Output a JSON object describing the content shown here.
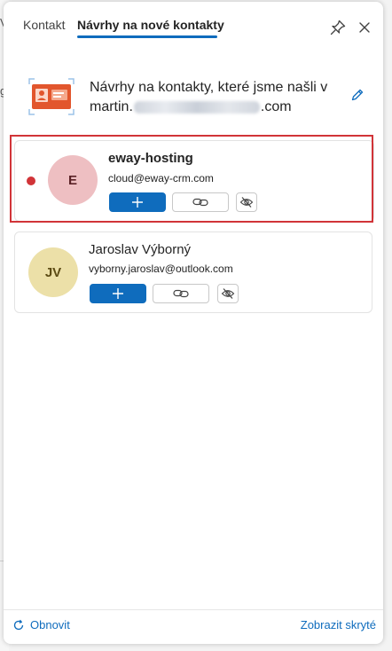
{
  "background": {
    "char_top": "V",
    "char_mid": "g"
  },
  "tabs": [
    {
      "label": "Kontakt",
      "active": false
    },
    {
      "label": "Návrhy na nové kontakty",
      "active": true
    }
  ],
  "intro": {
    "line1": "Návrhy na kontakty, které jsme našli v",
    "email_prefix": "martin.",
    "email_suffix": ".com"
  },
  "suggestions": [
    {
      "initials": "E",
      "name": "eway-hosting",
      "email": "cloud@eway-crm.com",
      "unread": true,
      "highlighted": true
    },
    {
      "initials": "JV",
      "name": "Jaroslav Výborný",
      "email": "vyborny.jaroslav@outlook.com",
      "unread": false,
      "highlighted": false
    }
  ],
  "footer": {
    "refresh_label": "Obnovit",
    "show_hidden_label": "Zobrazit skryté"
  },
  "colors": {
    "accent": "#0f6cbd",
    "highlight": "#d13438",
    "avatar_e": "#eebfc2",
    "avatar_jv": "#ece0a8"
  },
  "icons": [
    "pin-icon",
    "close-icon",
    "contact-card-icon",
    "edit-icon",
    "add-icon",
    "link-icon",
    "eye-off-icon",
    "refresh-icon"
  ]
}
